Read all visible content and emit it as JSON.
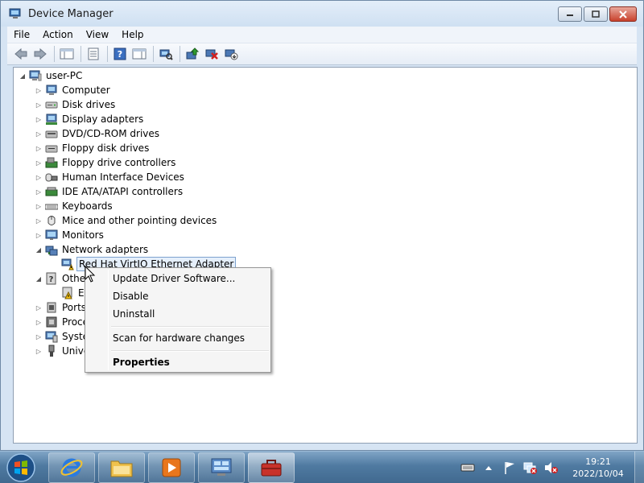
{
  "window": {
    "title": "Device Manager",
    "menu": [
      "File",
      "Action",
      "View",
      "Help"
    ]
  },
  "tree": {
    "root": "user-PC",
    "items": [
      {
        "label": "Computer",
        "icon": "computer-icon",
        "expanded": false
      },
      {
        "label": "Disk drives",
        "icon": "disk-drive-icon",
        "expanded": false
      },
      {
        "label": "Display adapters",
        "icon": "display-adapter-icon",
        "expanded": false
      },
      {
        "label": "DVD/CD-ROM drives",
        "icon": "dvd-drive-icon",
        "expanded": false
      },
      {
        "label": "Floppy disk drives",
        "icon": "floppy-drive-icon",
        "expanded": false
      },
      {
        "label": "Floppy drive controllers",
        "icon": "floppy-controller-icon",
        "expanded": false
      },
      {
        "label": "Human Interface Devices",
        "icon": "hid-icon",
        "expanded": false
      },
      {
        "label": "IDE ATA/ATAPI controllers",
        "icon": "ide-controller-icon",
        "expanded": false
      },
      {
        "label": "Keyboards",
        "icon": "keyboard-icon",
        "expanded": false
      },
      {
        "label": "Mice and other pointing devices",
        "icon": "mouse-icon",
        "expanded": false
      },
      {
        "label": "Monitors",
        "icon": "monitor-icon",
        "expanded": false
      },
      {
        "label": "Network adapters",
        "icon": "network-adapter-icon",
        "expanded": true
      },
      {
        "label": "Red Hat VirtIO Ethernet Adapter",
        "icon": "network-warning-icon",
        "child": true,
        "selected": true
      },
      {
        "label": "Othe",
        "icon": "unknown-device-icon",
        "expanded": true
      },
      {
        "label": "Et",
        "icon": "warning-device-icon",
        "child": true
      },
      {
        "label": "Ports",
        "icon": "ports-icon",
        "expanded": false
      },
      {
        "label": "Proce",
        "icon": "processor-icon",
        "expanded": false
      },
      {
        "label": "Syste",
        "icon": "system-devices-icon",
        "expanded": false
      },
      {
        "label": "Unive",
        "icon": "usb-icon",
        "expanded": false
      }
    ]
  },
  "context_menu": {
    "update_driver": "Update Driver Software...",
    "disable": "Disable",
    "uninstall": "Uninstall",
    "scan": "Scan for hardware changes",
    "properties": "Properties"
  },
  "taskbar": {
    "time": "19:21",
    "date": "2022/10/04",
    "pinned": [
      "internet-explorer-icon",
      "file-explorer-icon",
      "media-player-icon",
      "control-panel-icon",
      "device-manager-task-icon"
    ]
  },
  "colors": {
    "selection_border": "#7da2ce",
    "selection_fill": "#e5effb",
    "taskbar": "#4f7aa1"
  }
}
